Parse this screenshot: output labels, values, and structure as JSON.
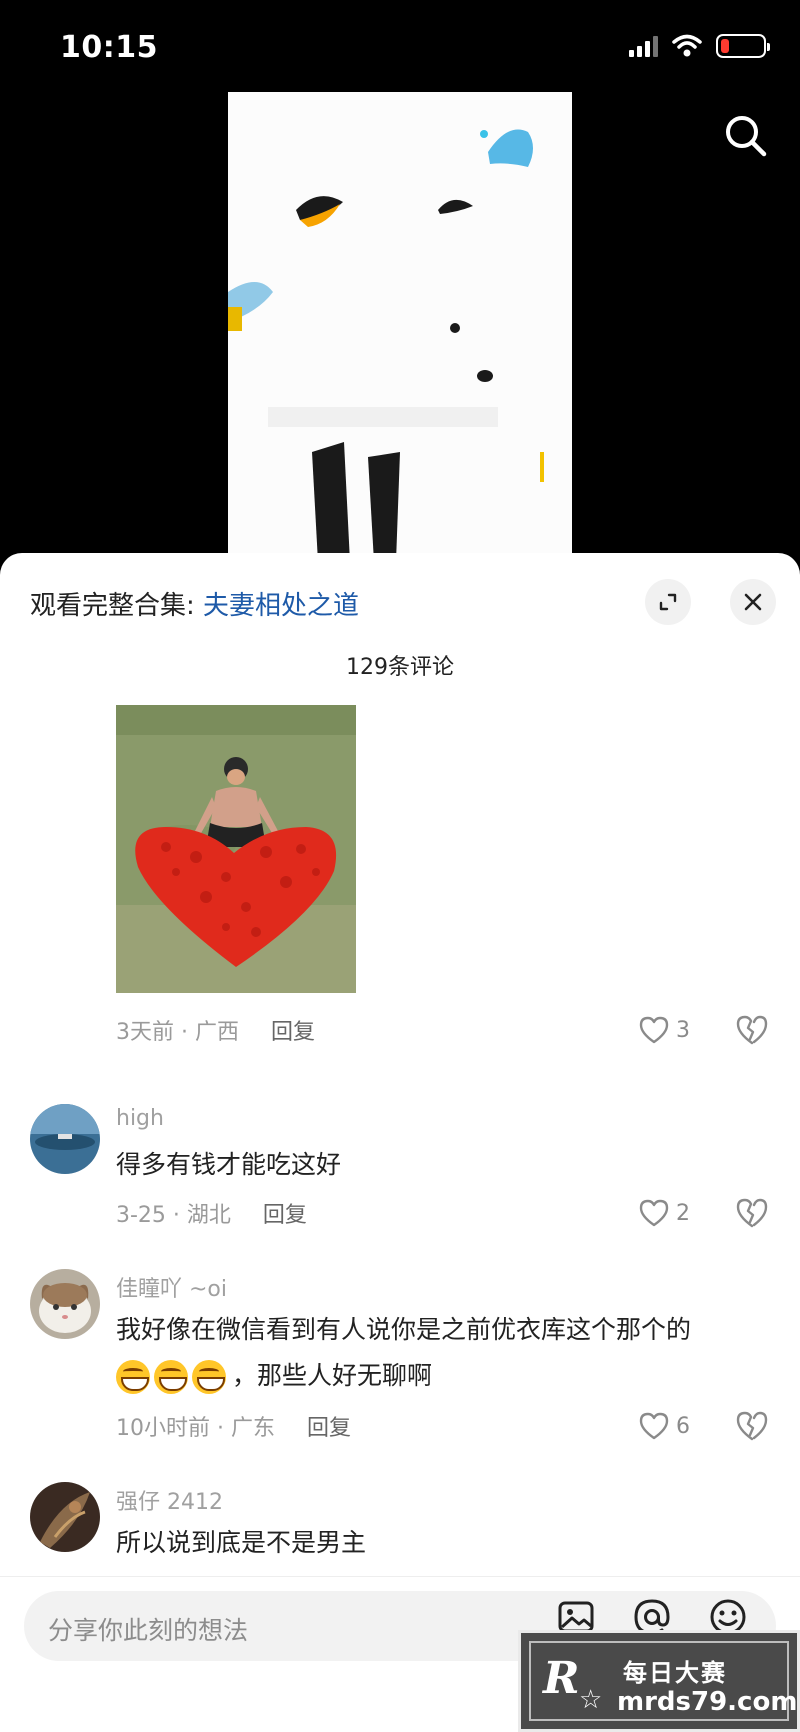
{
  "status_bar": {
    "time": "10:15",
    "icons": [
      "signal-icon",
      "wifi-icon",
      "battery-low-icon"
    ],
    "battery_color": "#ff3b30"
  },
  "video": {
    "search_icon": "search-icon"
  },
  "sheet": {
    "collection_prefix": "观看完整合集: ",
    "collection_name": "夫妻相处之道",
    "collection_color": "#1e5aa8",
    "expand_icon": "expand-icon",
    "close_icon": "close-icon",
    "comment_count": "129条评论"
  },
  "comments": [
    {
      "has_image": true,
      "time_location": "3天前 · 广西",
      "reply": "回复",
      "likes": "3"
    },
    {
      "user": "high",
      "text": "得多有钱才能吃这好",
      "time_location": "3-25 · 湖北",
      "reply": "回复",
      "likes": "2"
    },
    {
      "user": "佳瞳吖 ~oi",
      "text_line1": "我好像在微信看到有人说你是之前优衣库这个那个的",
      "emoji": [
        "grinning-sweat-emoji",
        "grinning-sweat-emoji",
        "grinning-sweat-emoji"
      ],
      "text_line2": "，那些人好无聊啊",
      "time_location": "10小时前 · 广东",
      "reply": "回复",
      "likes": "6"
    },
    {
      "user": "强仔 2412",
      "text": "所以说到底是不是男主"
    }
  ],
  "input_bar": {
    "placeholder": "分享你此刻的想法",
    "icons": [
      "image-icon",
      "at-icon",
      "emoji-icon"
    ]
  },
  "watermark": {
    "logo": "R",
    "title": "每日大赛",
    "url": "mrds79.com"
  }
}
